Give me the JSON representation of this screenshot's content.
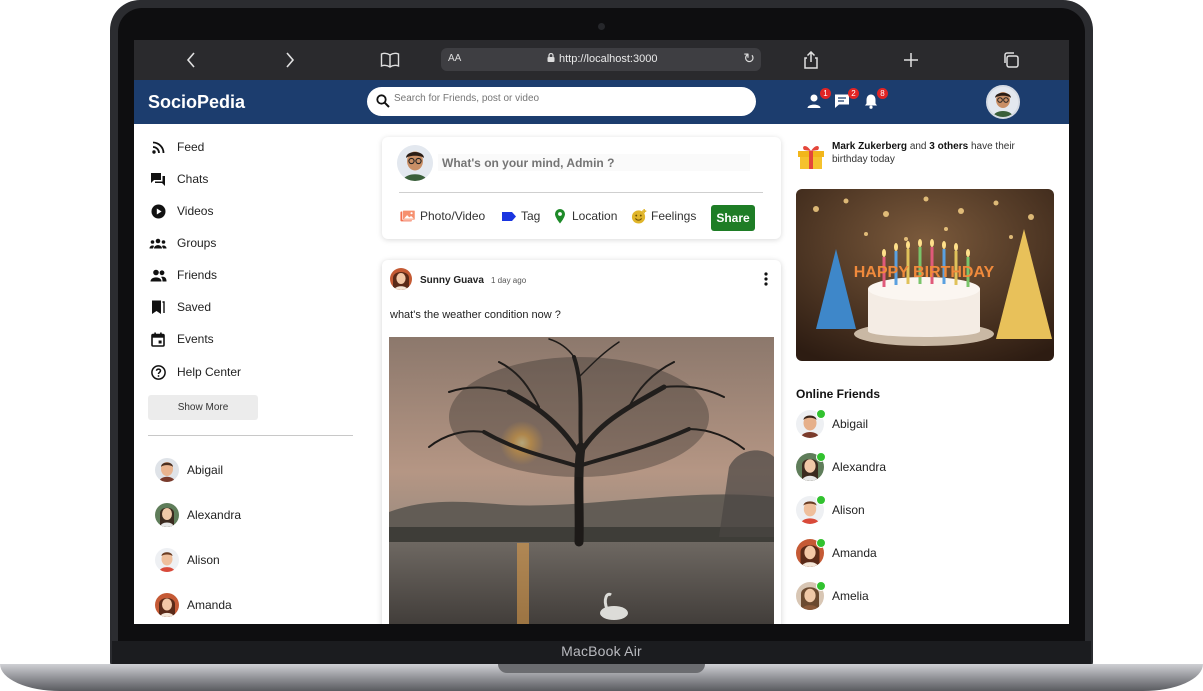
{
  "device": {
    "label": "MacBook Air"
  },
  "browser": {
    "back_icon": "chevron-left-icon",
    "forward_icon": "chevron-right-icon",
    "reader_label": "AA",
    "url": "http://localhost:3000"
  },
  "app": {
    "brand": "SocioPedia",
    "search_placeholder": "Search for Friends, post or video",
    "badges": {
      "friend_requests": "1",
      "messages": "2",
      "notifications": "8"
    },
    "colors": {
      "header": "#1c3d6e",
      "share_button": "#1e7d26",
      "badge": "#e02424",
      "online_dot": "#31c22f"
    }
  },
  "sidebar": {
    "items": [
      {
        "label": "Feed",
        "icon": "rss-icon"
      },
      {
        "label": "Chats",
        "icon": "chat-icon"
      },
      {
        "label": "Videos",
        "icon": "play-circle-icon"
      },
      {
        "label": "Groups",
        "icon": "groups-icon"
      },
      {
        "label": "Friends",
        "icon": "people-icon"
      },
      {
        "label": "Saved",
        "icon": "bookmark-icon"
      },
      {
        "label": "Events",
        "icon": "calendar-icon"
      },
      {
        "label": "Help Center",
        "icon": "help-circle-icon"
      }
    ],
    "show_more": "Show More",
    "friends": [
      "Abigail",
      "Alexandra",
      "Alison",
      "Amanda"
    ]
  },
  "composer": {
    "placeholder": "What's on your mind, Admin ?",
    "actions": [
      "Photo/Video",
      "Tag",
      "Location",
      "Feelings"
    ],
    "share": "Share"
  },
  "post": {
    "author": "Sunny Guava",
    "time": "1 day ago",
    "text": "what's the weather condition now ?"
  },
  "rightbar": {
    "birthday_name": "Mark Zukerberg",
    "birthday_and": "and",
    "birthday_others": "3 others",
    "birthday_rest": "have their birthday today",
    "cake_text": "HAPPY BIRTHDAY",
    "online_title": "Online Friends",
    "online_friends": [
      "Abigail",
      "Alexandra",
      "Alison",
      "Amanda",
      "Amelia"
    ]
  }
}
